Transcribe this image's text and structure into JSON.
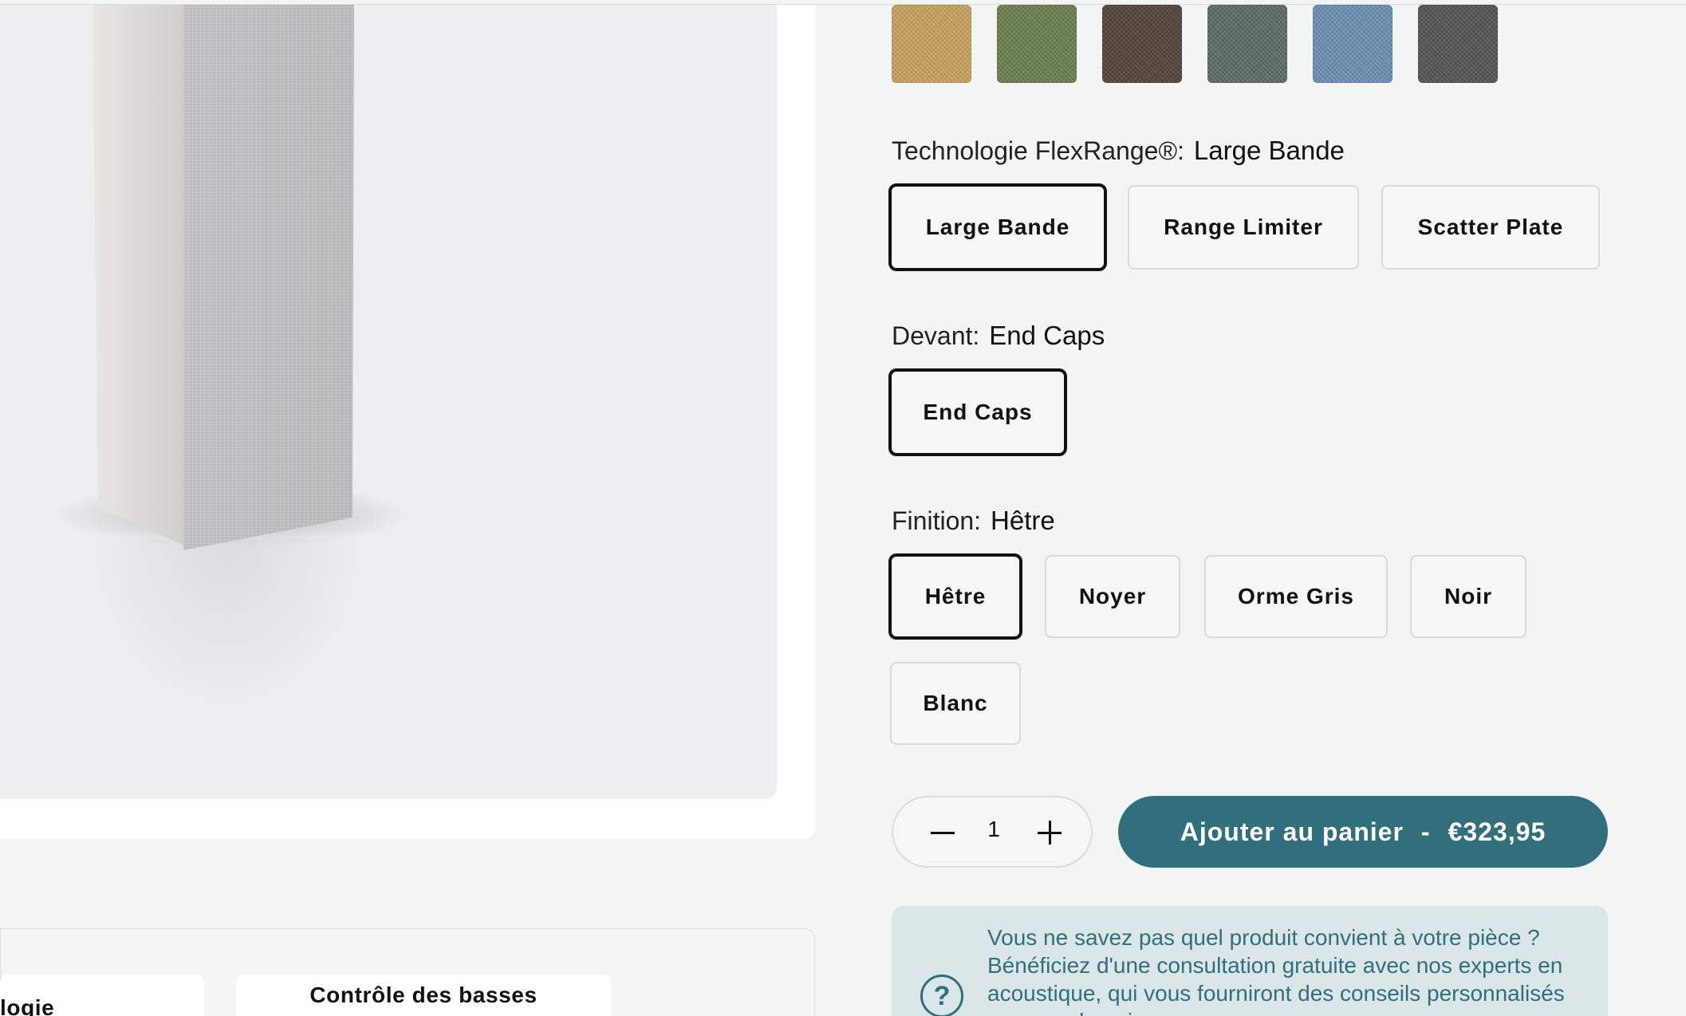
{
  "swatches": [
    {
      "name": "ochre",
      "color": "#c9a35f"
    },
    {
      "name": "green",
      "color": "#6c7f4f"
    },
    {
      "name": "brown",
      "color": "#54453c"
    },
    {
      "name": "slate-green",
      "color": "#5d6c67"
    },
    {
      "name": "blue",
      "color": "#6e8fb2"
    },
    {
      "name": "dark-grey",
      "color": "#555556"
    }
  ],
  "flexrange": {
    "label": "Technologie FlexRange®:",
    "selected": "Large Bande",
    "options": [
      "Large Bande",
      "Range Limiter",
      "Scatter Plate"
    ]
  },
  "front": {
    "label": "Devant:",
    "selected": "End Caps",
    "options": [
      "End Caps"
    ]
  },
  "finish": {
    "label": "Finition:",
    "selected": "Hêtre",
    "options": [
      "Hêtre",
      "Noyer",
      "Orme Gris",
      "Noir",
      "Blanc"
    ]
  },
  "quantity": {
    "value": "1"
  },
  "cart": {
    "label": "Ajouter au panier",
    "separator": "-",
    "price": "€323,95"
  },
  "help": {
    "text": "Vous ne savez pas quel produit convient à votre pièce ? Bénéficiez d'une consultation gratuite avec nos experts en acoustique, qui vous fourniront des conseils personnalisés pour vos besoins."
  },
  "features": [
    "logie",
    "Contrôle des basses"
  ],
  "colors": {
    "accent": "#326f7c",
    "help_bg": "#dbe6e9"
  }
}
